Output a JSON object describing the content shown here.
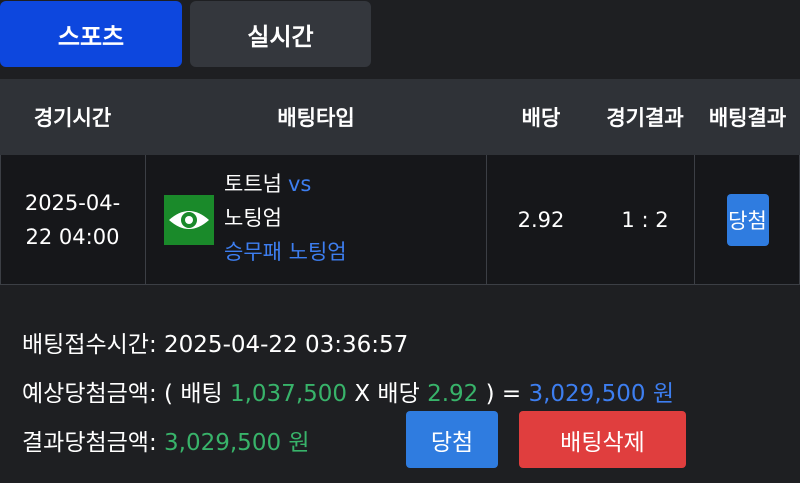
{
  "tabs": [
    {
      "label": "스포츠",
      "active": true
    },
    {
      "label": "실시간",
      "active": false
    }
  ],
  "table": {
    "headers": [
      "경기시간",
      "배팅타입",
      "배당",
      "경기결과",
      "배팅결과"
    ],
    "row": {
      "time_line1": "2025-04-",
      "time_line2": "22 04:00",
      "icon": "eye-icon",
      "home_team": "토트넘",
      "vs": "vs",
      "away_team": "노팅엄",
      "bet_pick": "승무패 노팅엄",
      "odds": "2.92",
      "score": "1 : 2",
      "status": "당첨"
    }
  },
  "summary": {
    "bet_time_label": "배팅접수시간:",
    "bet_time_value": "2025-04-22 03:36:57",
    "expected_label": "예상당첨금액:",
    "open_paren": "(",
    "bet_word": "배팅",
    "bet_amount": "1,037,500",
    "multiply": "X",
    "odds_word": "배당",
    "odds_value": "2.92",
    "close_eq": ") =",
    "expected_amount": "3,029,500 원",
    "result_label": "결과당첨금액:",
    "result_amount": "3,029,500 원"
  },
  "buttons": {
    "win_label": "당첨",
    "delete_label": "배팅삭제"
  },
  "colors": {
    "active_tab": "#0d47de",
    "inactive_tab": "#34373d",
    "header_bg": "#2f3237",
    "row_bg": "#16171a",
    "accent_blue": "#3d7ef0",
    "accent_green": "#38b36a",
    "badge_blue": "#2f7ce0",
    "delete_red": "#e03e3e",
    "eye_box_green": "#1a8a2a"
  }
}
